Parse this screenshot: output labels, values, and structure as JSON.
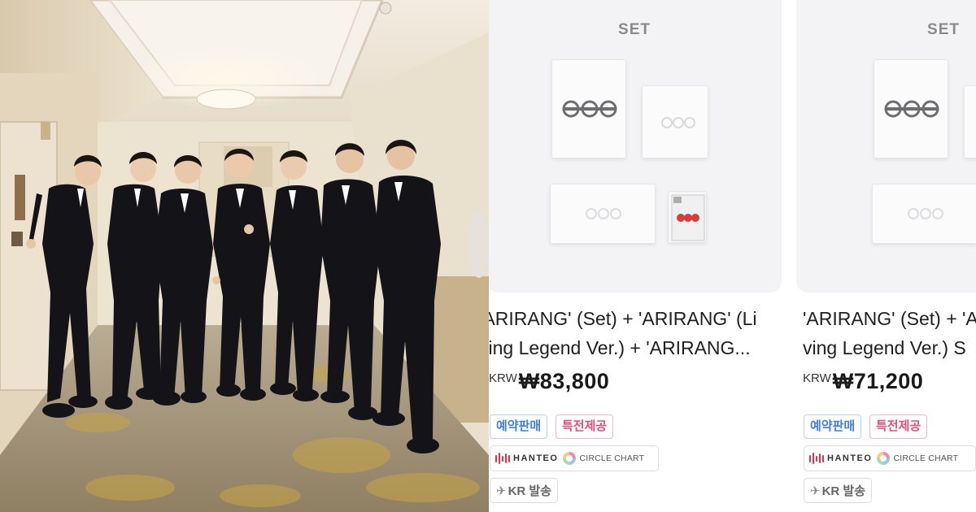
{
  "photo": {
    "alt_icon": "group-photo"
  },
  "products": [
    {
      "set_label": "SET",
      "title_lines": [
        "'ARIRANG' (Set) + 'ARIRANG' (Li",
        "ving Legend Ver.) + 'ARIRANG..."
      ],
      "currency": "KRW",
      "price": "₩83,800",
      "badges": [
        "예약판매",
        "특전제공"
      ],
      "chart_hanteo": "HANTEO",
      "chart_circle": "CIRCLE CHART",
      "ship": "KR 발송",
      "colors": {
        "preorder": "#3f82d8",
        "bonus": "#e0507e",
        "hanteo": "#e4304c"
      }
    },
    {
      "set_label": "SET",
      "title_lines": [
        "'ARIRANG' (Set) + 'A",
        "ving Legend Ver.) S"
      ],
      "currency": "KRW",
      "price": "₩71,200",
      "badges": [
        "예약판매",
        "특전제공"
      ],
      "chart_hanteo": "HANTEO",
      "chart_circle": "CIRCLE CHART",
      "ship": "KR 발송"
    }
  ]
}
